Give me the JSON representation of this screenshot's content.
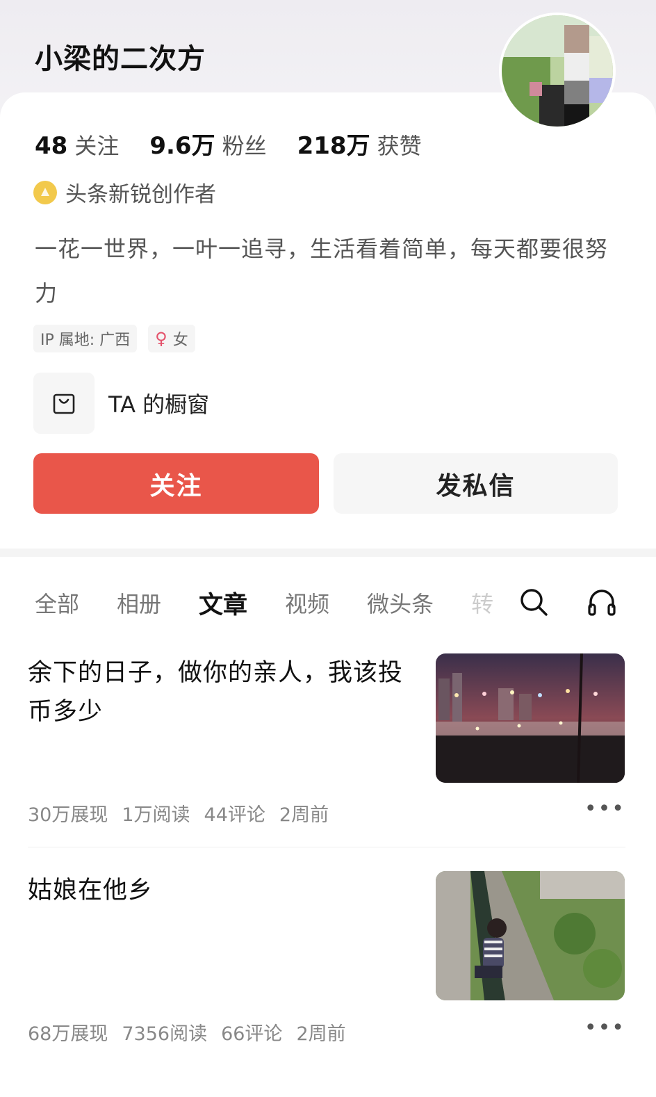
{
  "profile": {
    "username": "小梁的二次方",
    "stats": [
      {
        "num": "48",
        "label": "关注"
      },
      {
        "num": "9.6万",
        "label": "粉丝"
      },
      {
        "num": "218万",
        "label": "获赞"
      }
    ],
    "badge": "头条新锐创作者",
    "bio": "一花一世界，一叶一追寻，生活看着简单，每天都要很努力",
    "ip_tag": "IP 属地: 广西",
    "gender_symbol": "♀",
    "gender": "女",
    "shop_label": "TA 的橱窗"
  },
  "actions": {
    "follow": "关注",
    "message": "发私信"
  },
  "tabs": [
    "全部",
    "相册",
    "文章",
    "视频",
    "微头条",
    "转"
  ],
  "active_tab": "文章",
  "articles": [
    {
      "title": "余下的日子，做你的亲人，我该投币多少",
      "impressions": "30万展现",
      "reads": "1万阅读",
      "comments": "44评论",
      "time": "2周前"
    },
    {
      "title": "姑娘在他乡",
      "impressions": "68万展现",
      "reads": "7356阅读",
      "comments": "66评论",
      "time": "2周前"
    }
  ],
  "more_label": "•••",
  "colors": {
    "follow_button": "#e9564a",
    "badge": "#f2c94c",
    "gender": "#e4526b"
  }
}
